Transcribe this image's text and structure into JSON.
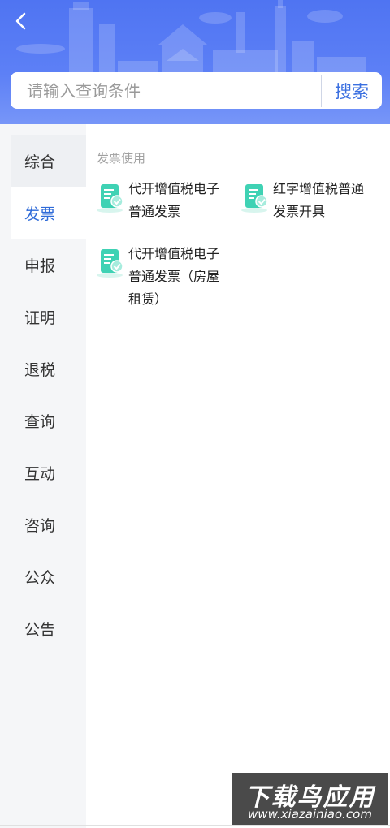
{
  "header": {
    "search": {
      "placeholder": "请输入查询条件",
      "button_label": "搜索"
    }
  },
  "sidebar": {
    "items": [
      {
        "label": "综合"
      },
      {
        "label": "发票",
        "active": true
      },
      {
        "label": "申报"
      },
      {
        "label": "证明"
      },
      {
        "label": "退税"
      },
      {
        "label": "查询"
      },
      {
        "label": "互动"
      },
      {
        "label": "咨询"
      },
      {
        "label": "公众"
      },
      {
        "label": "公告"
      }
    ]
  },
  "content": {
    "section_title": "发票使用",
    "entries": [
      {
        "line1": "代开增值税电子",
        "line2": "普通发票",
        "line3": "",
        "icon": "invoice-check-icon"
      },
      {
        "line1": "红字增值税普通",
        "line2": "发票开具",
        "line3": "",
        "icon": "invoice-check-icon"
      },
      {
        "line1": "代开增值税电子",
        "line2": "普通发票（房屋",
        "line3": "租赁）",
        "icon": "invoice-check-icon"
      }
    ]
  },
  "watermark": {
    "title": "下载鸟应用",
    "url": "www.xiazainiao.com"
  },
  "colors": {
    "header": "#5a7cf4",
    "accent": "#2f6bd8",
    "icon": "#3fd2b4"
  }
}
